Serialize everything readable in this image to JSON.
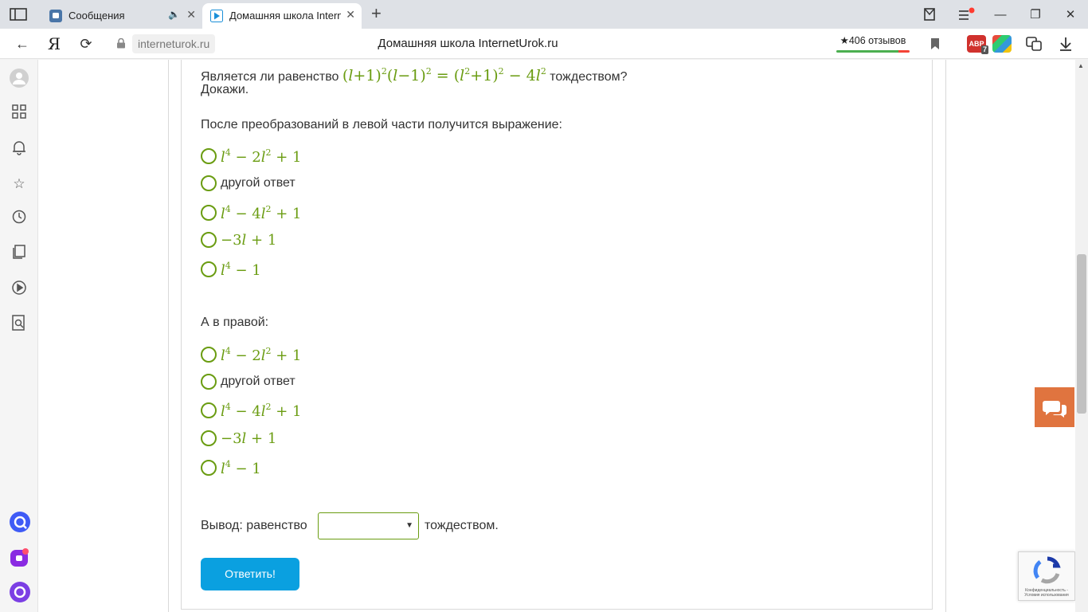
{
  "tabs": [
    {
      "title": "Сообщения",
      "active": false,
      "audio_icon": "speaker-muted-icon"
    },
    {
      "title": "Домашняя школа Intern",
      "active": true
    }
  ],
  "address_bar": {
    "domain": "interneturok.ru",
    "page_title": "Домашняя школа InternetUrok.ru",
    "reviews_label": "★406 отзывов"
  },
  "extensions": {
    "adblock_badge": "7"
  },
  "question": {
    "text_before": "Является ли равенство",
    "text_after": "тождеством?",
    "prove": "Докажи.",
    "left_prompt": "После преобразований в левой части получится выражение:",
    "right_prompt": "А в правой:"
  },
  "left_options": [
    {
      "kind": "math",
      "id": "l4-2l2+1"
    },
    {
      "kind": "text",
      "label": "другой ответ"
    },
    {
      "kind": "math",
      "id": "l4-4l2+1"
    },
    {
      "kind": "math",
      "id": "-3l+1"
    },
    {
      "kind": "math",
      "id": "l4-1"
    }
  ],
  "right_options": [
    {
      "kind": "math",
      "id": "l4-2l2+1"
    },
    {
      "kind": "text",
      "label": "другой ответ"
    },
    {
      "kind": "math",
      "id": "l4-4l2+1"
    },
    {
      "kind": "math",
      "id": "-3l+1"
    },
    {
      "kind": "math",
      "id": "l4-1"
    }
  ],
  "conclusion": {
    "before": "Вывод: равенство",
    "selected_value": "",
    "after": "тождеством."
  },
  "submit_label": "Ответить!",
  "recaptcha": {
    "footer": "Конфиденциальность - Условия использования"
  },
  "colors": {
    "accent_green": "#6a9c11",
    "button_blue": "#0aa0e0",
    "chat_orange": "#e0743f"
  }
}
